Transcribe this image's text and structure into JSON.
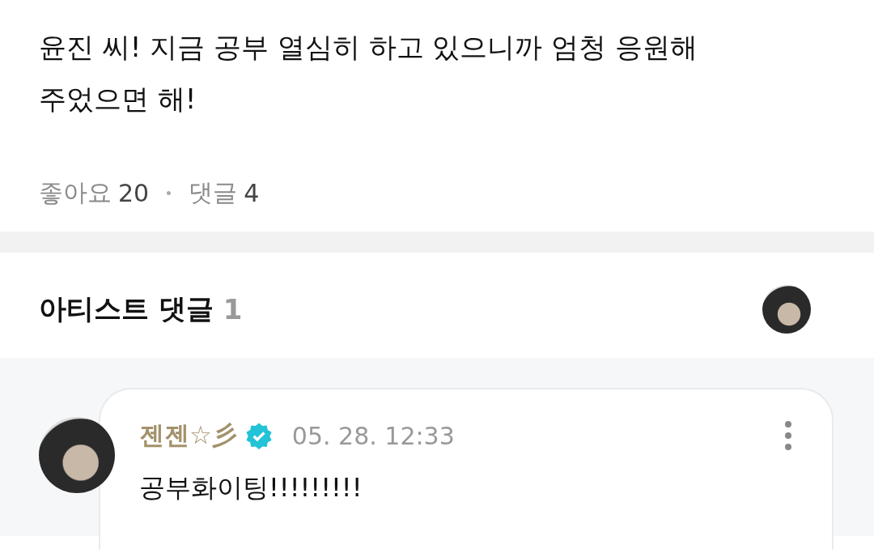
{
  "post": {
    "text": "윤진 씨! 지금 공부 열심히 하고 있으니까 엄청 응원해 주었으면 해!",
    "likes_label": "좋아요",
    "likes_count": "20",
    "comments_label": "댓글",
    "comments_count": "4"
  },
  "artist_comments": {
    "title": "아티스트 댓글",
    "count": "1",
    "comments": [
      {
        "author": "젠젠☆彡",
        "verified": true,
        "time": "05. 28. 12:33",
        "text": "공부화이팅!!!!!!!!!"
      }
    ]
  }
}
